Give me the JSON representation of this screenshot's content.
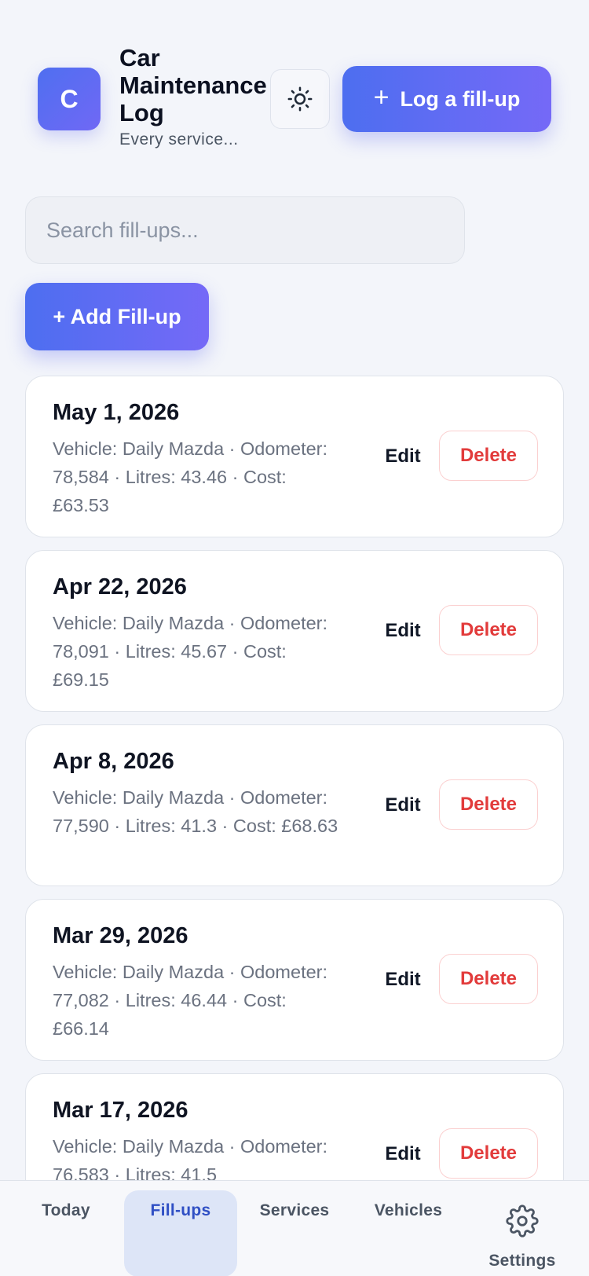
{
  "header": {
    "avatar_letter": "C",
    "title": "Car\nMaintenance\nLog",
    "subtitle": "Every service...",
    "theme_icon": "sun-icon",
    "log_button_label": "Log a fill-up"
  },
  "search": {
    "placeholder": "Search fill-ups...",
    "value": ""
  },
  "add_button_label": "+ Add Fill-up",
  "fillups": [
    {
      "date": "May 1, 2026",
      "details": "Vehicle: Daily Mazda · Odometer: 78,584 · Litres: 43.46 · Cost: £63.53",
      "edit": "Edit",
      "delete": "Delete"
    },
    {
      "date": "Apr 22, 2026",
      "details": "Vehicle: Daily Mazda · Odometer: 78,091 · Litres: 45.67 · Cost: £69.15",
      "edit": "Edit",
      "delete": "Delete"
    },
    {
      "date": "Apr 8, 2026",
      "details": "Vehicle: Daily Mazda · Odometer: 77,590 · Litres: 41.3 · Cost: £68.63",
      "edit": "Edit",
      "delete": "Delete"
    },
    {
      "date": "Mar 29, 2026",
      "details": "Vehicle: Daily Mazda · Odometer: 77,082 · Litres: 46.44 · Cost: £66.14",
      "edit": "Edit",
      "delete": "Delete"
    },
    {
      "date": "Mar 17, 2026",
      "details": "Vehicle: Daily Mazda · Odometer: 76,583 · Litres: 41.5",
      "edit": "Edit",
      "delete": "Delete"
    }
  ],
  "nav": {
    "today": "Today",
    "fillups": "Fill-ups",
    "services": "Services",
    "vehicles": "Vehicles",
    "settings": "Settings",
    "active": "fillups",
    "settings_icon": "gear-icon"
  },
  "colors": {
    "accent_start": "#4d6ef0",
    "accent_end": "#7569f7",
    "danger": "#e23b3b",
    "nav_active": "#2f4fc4"
  }
}
